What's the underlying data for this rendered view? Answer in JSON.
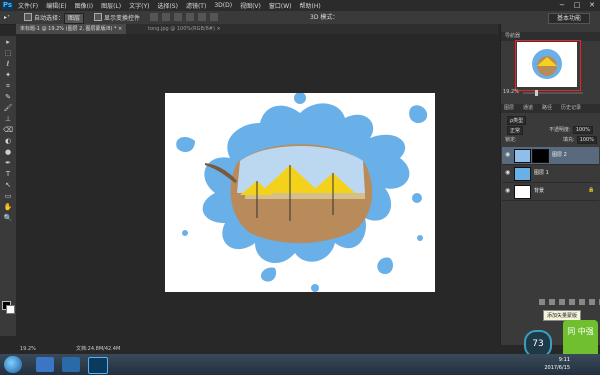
{
  "app": {
    "logo": "Ps"
  },
  "menu": [
    "文件(F)",
    "编辑(E)",
    "图像(I)",
    "图层(L)",
    "文字(Y)",
    "选择(S)",
    "滤镜(T)",
    "3D(D)",
    "视图(V)",
    "窗口(W)",
    "帮助(H)"
  ],
  "window_controls": {
    "minimize": "−",
    "maximize": "□",
    "close": "✕"
  },
  "options": {
    "auto_select_label": "自动选择：",
    "auto_select_value": "图层",
    "show_transform_label": "显示变换控件",
    "mode_3d": "3D 模式：",
    "workspace": "基本功能"
  },
  "tabs": [
    {
      "label": "未标题-1 @ 19.2% (图层 2, 图层蒙版/8) *",
      "close": "×"
    },
    {
      "label": "tong.jpg @ 100%(RGB/8#)",
      "close": "×"
    }
  ],
  "status": {
    "zoom": "19.2%",
    "doc": "文档:24.8M/42.4M"
  },
  "tools": [
    "▸",
    "⬚",
    "ℓ",
    "✦",
    "⌗",
    "✎",
    "🖌",
    "⊥",
    "⌫",
    "◐",
    "●",
    "✒",
    "T",
    "↖",
    "▭",
    "✋",
    "🔍"
  ],
  "navigator": {
    "tab1": "导航器",
    "zoom": "19.2%"
  },
  "layers_panel": {
    "tabs": [
      "图层",
      "通道",
      "路径",
      "历史记录"
    ],
    "kind": "ρ类型",
    "blend": "正常",
    "opacity_label": "不透明度:",
    "opacity": "100%",
    "lock_label": "锁定:",
    "fill_label": "填充:",
    "fill": "100%",
    "layers": [
      {
        "name": "图层 2",
        "visible": true,
        "active": true,
        "has_mask": true
      },
      {
        "name": "图层 1",
        "visible": true,
        "active": false,
        "has_mask": false
      },
      {
        "name": "背景",
        "visible": true,
        "active": false,
        "has_mask": false
      }
    ],
    "tooltip": "添加矢量蒙版"
  },
  "taskbar": {
    "time": "9:11",
    "date": "2017/6/15"
  },
  "widgets": {
    "gauge": "73",
    "badge": "同\n中强"
  },
  "colors": {
    "accent": "#4fb3ff",
    "panel": "#3a3a3a",
    "background": "#282828"
  }
}
